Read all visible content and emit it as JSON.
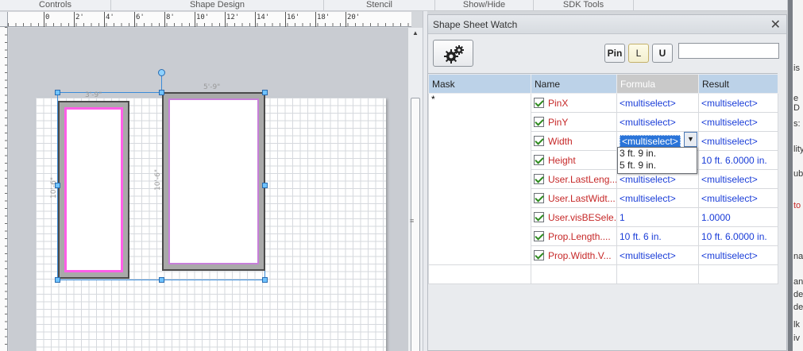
{
  "ribbon": {
    "groups": [
      "Controls",
      "Shape Design",
      "Stencil",
      "Show/Hide",
      "SDK Tools"
    ]
  },
  "ruler": {
    "ticks": [
      "0",
      "2'",
      "4'",
      "6'",
      "8'",
      "10'",
      "12'",
      "14'",
      "16'",
      "18'",
      "20'"
    ]
  },
  "canvas": {
    "dim_top_1": "3'-9\"",
    "dim_top_2": "5'-9\"",
    "dim_side_1": "10'-6\"",
    "dim_side_2": "10'-6\""
  },
  "watch": {
    "title": "Shape Sheet Watch",
    "close_glyph": "✕",
    "buttons": {
      "pin": "Pin",
      "l": "L",
      "u": "U"
    },
    "search_value": "",
    "columns": {
      "mask": "Mask",
      "name": "Name",
      "formula": "Formula",
      "result": "Result"
    },
    "mask_value": "*",
    "rows": [
      {
        "name": "PinX",
        "formula": "<multiselect>",
        "result": "<multiselect>"
      },
      {
        "name": "PinY",
        "formula": "<multiselect>",
        "result": "<multiselect>"
      },
      {
        "name": "Width",
        "formula": "<multiselect>",
        "result": "<multiselect>"
      },
      {
        "name": "Height",
        "formula": "",
        "result": "10 ft. 6.0000 in."
      },
      {
        "name": "User.LastLeng...",
        "formula": "<multiselect>",
        "result": "<multiselect>"
      },
      {
        "name": "User.LastWidt...",
        "formula": "<multiselect>",
        "result": "<multiselect>"
      },
      {
        "name": "User.visBESele...",
        "formula": "1",
        "result": "1.0000"
      },
      {
        "name": "Prop.Length....",
        "formula": "10 ft. 6 in.",
        "result": "10 ft. 6.0000 in."
      },
      {
        "name": "Prop.Width.V...",
        "formula": "<multiselect>",
        "result": "<multiselect>"
      }
    ],
    "dropdown": {
      "selected": "<multiselect>",
      "options": [
        "3 ft. 9 in.",
        "5 ft. 9 in."
      ]
    }
  },
  "right_strip": [
    "is",
    "e D",
    "s:",
    "lity",
    "ub",
    "to",
    "na",
    "an",
    "de",
    "de",
    "lk",
    "iv"
  ]
}
